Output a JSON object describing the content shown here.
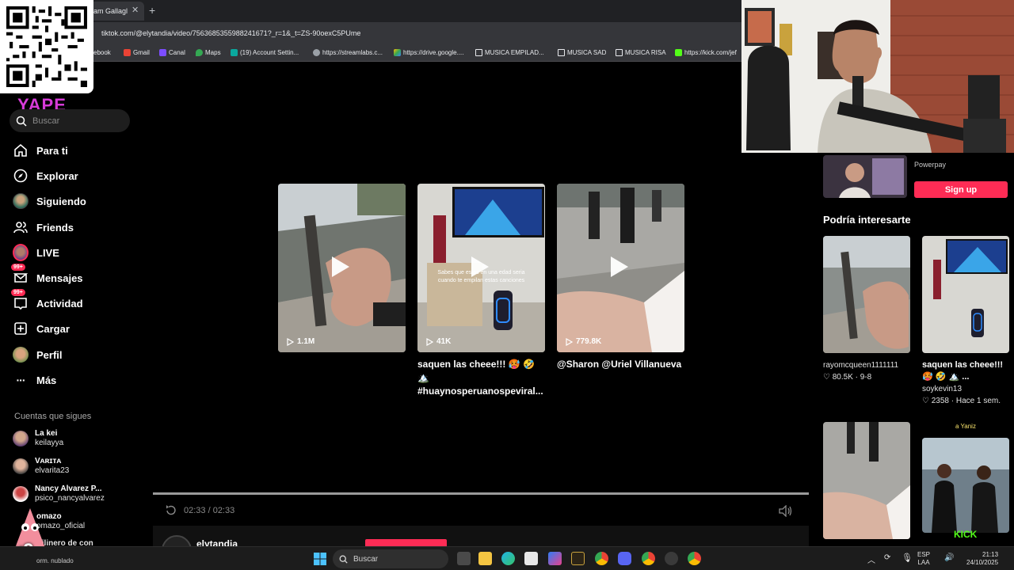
{
  "browser": {
    "tab_title": "am Gallagl",
    "url": "tiktok.com/@elytandia/video/7563685355988241671?_r=1&_t=ZS-90oexC5PUme",
    "bookmarks": [
      "ebook",
      "Gmail",
      "Canal",
      "Maps",
      "(19) Account Settin...",
      "https://streamlabs.c...",
      "https://drive.google....",
      "MUSICA EMPILAD...",
      "MUSICA SAD",
      "MUSICA RISA",
      "https://kick.com/jef"
    ]
  },
  "sidebar": {
    "logo": "YAPE",
    "search_placeholder": "Buscar",
    "nav": [
      {
        "label": "Para ti",
        "icon": "home-icon"
      },
      {
        "label": "Explorar",
        "icon": "compass-icon"
      },
      {
        "label": "Siguiendo",
        "icon": "avatar-icon"
      },
      {
        "label": "Friends",
        "icon": "friends-icon"
      },
      {
        "label": "LIVE",
        "icon": "live-avatar-icon"
      },
      {
        "label": "Mensajes",
        "icon": "message-icon",
        "badge": "99+"
      },
      {
        "label": "Actividad",
        "icon": "inbox-icon",
        "badge": "99+"
      },
      {
        "label": "Cargar",
        "icon": "upload-icon"
      },
      {
        "label": "Perfil",
        "icon": "profile-avatar-icon"
      },
      {
        "label": "Más",
        "icon": "more-icon"
      }
    ],
    "following_header": "Cuentas que sigues",
    "following": [
      {
        "name": "La kei",
        "handle": "keilayya"
      },
      {
        "name": "Vᴀʀɪᴛᴀ",
        "handle": "elvarita23"
      },
      {
        "name": "Nancy Alvarez P...",
        "handle": "psico_nancyalvarez"
      },
      {
        "name": "omazo",
        "handle": "omazo_oficial"
      },
      {
        "name": "lilinero de con",
        "handle": ""
      }
    ]
  },
  "videos": [
    {
      "views": "1.1M",
      "caption": ""
    },
    {
      "views": "41K",
      "caption": "saquen las cheee!!! 🥵 🤣 🏔️ #huaynosperuanos‌peviral...",
      "overlay": "Sabes que estas en una edad seria cuando te empilan estas canciones"
    },
    {
      "views": "779.8K",
      "caption": "@Sharon @Uriel Villanueva"
    }
  ],
  "player": {
    "time": "02:33 / 02:33",
    "progress": 1.0,
    "username": "elytandia"
  },
  "right_panel": {
    "ad_label": "Powerpay",
    "signup": "Sign up",
    "title": "Podría interesarte",
    "items": [
      {
        "user": "rayomcqueen1111111",
        "likes": "80.5K",
        "date": "9-8",
        "caption": ""
      },
      {
        "user": "soykevin13",
        "likes": "2358",
        "date": "Hace 1 sem.",
        "caption": "saquen las cheee!!! 🥵 🤣 🏔️ ..."
      }
    ],
    "bottom_label": "a Yaniz",
    "kick_label": "KICK"
  },
  "taskbar": {
    "weather": "orm. nublado",
    "search": "Buscar",
    "lang1": "ESP",
    "lang2": "LAA",
    "clock_time": "21:13",
    "clock_date": "24/10/2025",
    "x9": "x9"
  },
  "colors": {
    "accent": "#fe2c55",
    "logo": "#d63bd8"
  }
}
